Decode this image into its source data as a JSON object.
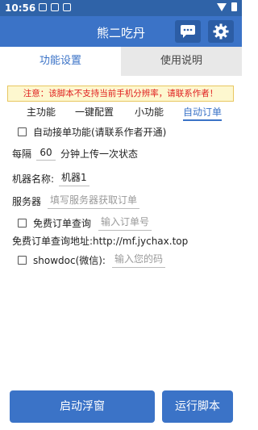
{
  "status_bar": {
    "time": "10:56"
  },
  "app_bar": {
    "title": "熊二吃丹",
    "chat_icon": "chat-bubble-icon",
    "settings_icon": "gear-icon"
  },
  "tabs": [
    {
      "label": "功能设置"
    },
    {
      "label": "使用说明"
    }
  ],
  "notice": "注意：该脚本不支持当前手机分辨率，请联系作者！",
  "subtabs": [
    {
      "label": "主功能"
    },
    {
      "label": "一键配置"
    },
    {
      "label": "小功能"
    },
    {
      "label": "自动订单"
    }
  ],
  "form": {
    "auto_accept_label": "自动接单功能(请联系作者开通)",
    "interval_prefix": "每隔",
    "interval_value": "60",
    "interval_suffix": "分钟上传一次状态",
    "machine_label": "机器名称:",
    "machine_value": "机器1",
    "server_label": "服务器",
    "server_placeholder": "填写服务器获取订单",
    "free_query_label": "免费订单查询",
    "order_placeholder": "输入订单号",
    "free_query_url_text": "免费订单查询地址:http://mf.jychax.top",
    "showdoc_label": "showdoc(微信):",
    "showdoc_placeholder": "输入您的码"
  },
  "buttons": {
    "float": "启动浮窗",
    "run": "运行脚本"
  }
}
